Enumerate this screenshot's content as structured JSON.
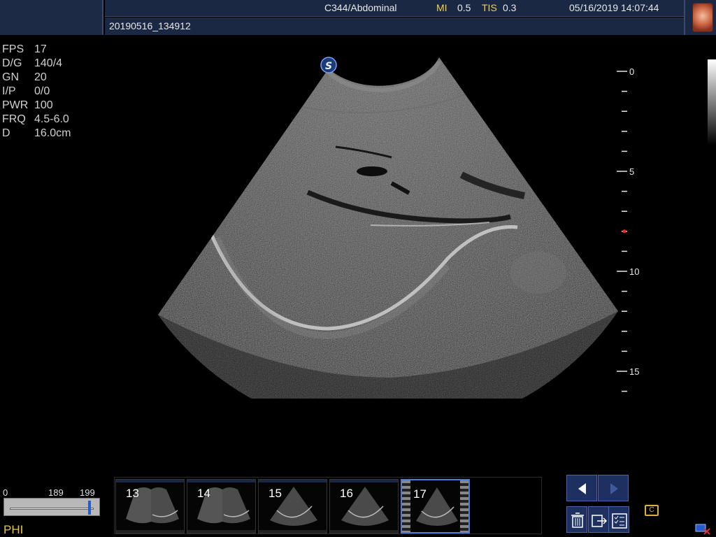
{
  "header": {
    "probe_preset": "C344/Abdominal",
    "mi_label": "MI",
    "mi_value": "0.5",
    "tis_label": "TIS",
    "tis_value": "0.3",
    "datetime": "05/16/2019 14:07:44",
    "study_id": "20190516_134912"
  },
  "params": [
    {
      "label": "FPS",
      "value": "17"
    },
    {
      "label": "D/G",
      "value": "140/4"
    },
    {
      "label": "GN",
      "value": "20"
    },
    {
      "label": "I/P",
      "value": "0/0"
    },
    {
      "label": "PWR",
      "value": "100"
    },
    {
      "label": "FRQ",
      "value": "4.5-6.0"
    },
    {
      "label": "D",
      "value": "16.0cm"
    }
  ],
  "depth_scale": {
    "labels": [
      "0",
      "5",
      "10",
      "15"
    ]
  },
  "orientation_marker": "S",
  "gain": {
    "min": "0",
    "current": "189",
    "max": "199",
    "fraction": 0.95
  },
  "preset_label": "PHI",
  "thumbnails": [
    {
      "num": "13",
      "selected": false
    },
    {
      "num": "14",
      "selected": false
    },
    {
      "num": "15",
      "selected": false
    },
    {
      "num": "16",
      "selected": false
    },
    {
      "num": "17",
      "selected": true
    }
  ],
  "icons": {
    "organ": "abdomen-organ-icon",
    "prev": "triangle-left-icon",
    "next": "triangle-right-icon",
    "delete": "trash-icon",
    "export": "export-icon",
    "checklist": "checklist-icon",
    "cine": "cine-icon",
    "network": "network-icon"
  },
  "colors": {
    "header_bg": "#1a2844",
    "accent_yellow": "#f2d34b",
    "button_bg": "#1d3060"
  }
}
